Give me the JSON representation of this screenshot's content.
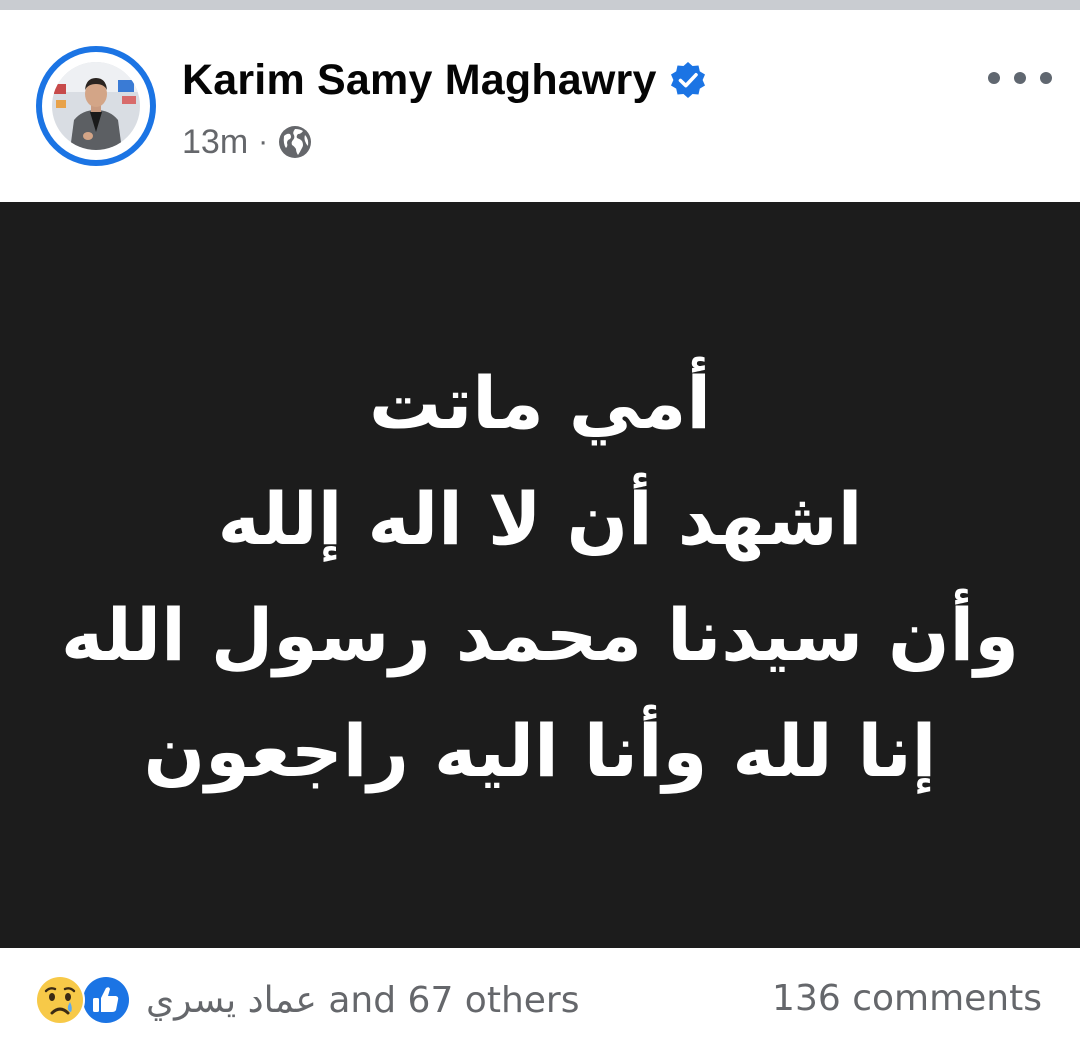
{
  "post": {
    "author": "Karim Samy Maghawry",
    "time": "13m",
    "separator": "·",
    "privacy_icon": "globe-icon",
    "verified_icon": "verified-badge-icon",
    "menu_icon": "more-options-icon"
  },
  "image_text": {
    "line1": "أمي ماتت",
    "line2": "اشهد أن لا اله إلله",
    "line3": "وأن سيدنا محمد رسول الله",
    "line4": "إنا لله وأنا اليه راجعون"
  },
  "footer": {
    "reaction_icons": [
      "sad-reaction-icon",
      "like-reaction-icon"
    ],
    "reactor_name": "عماد يسري",
    "reactors_suffix": "and 67 others",
    "comments": "136 comments"
  },
  "colors": {
    "accent": "#1b74e4",
    "text_primary": "#050505",
    "text_secondary": "#65676b",
    "image_background": "#1c1c1c",
    "top_strip": "#c9ccd1"
  }
}
